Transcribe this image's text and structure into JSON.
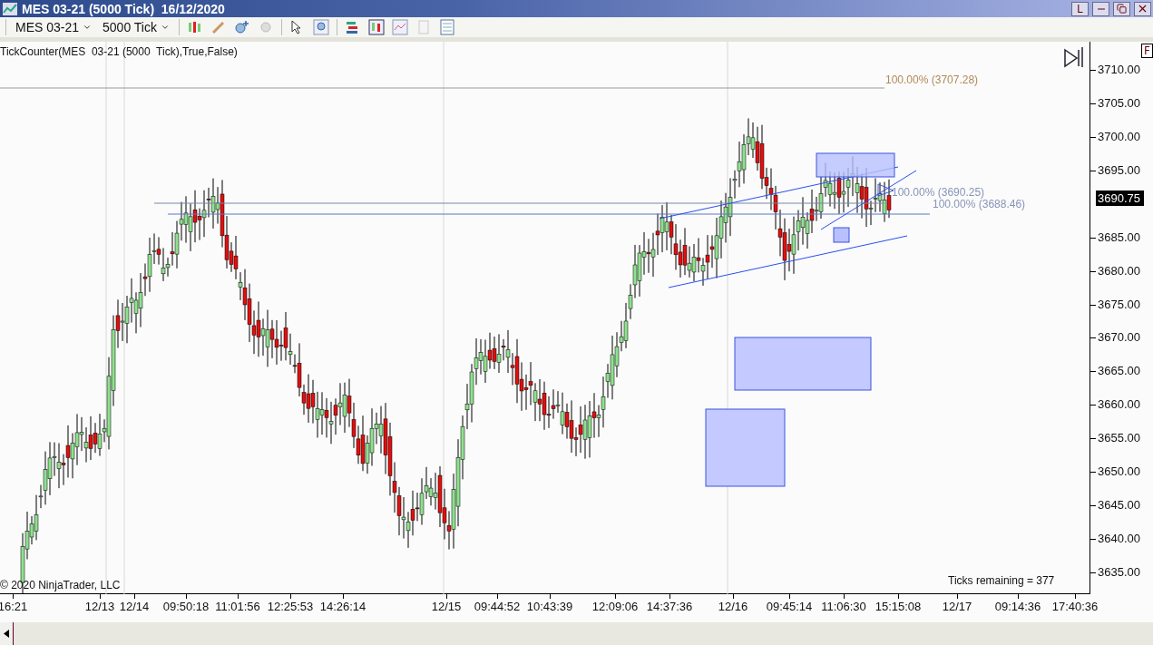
{
  "window": {
    "title": "MES 03-21 (5000 Tick)  16/12/2020",
    "buttons": [
      "L"
    ]
  },
  "toolbar": {
    "instrument": "MES 03-21",
    "interval": "5000 Tick"
  },
  "chart": {
    "indicator_label": "TickCounter(MES  03-21 (5000  Tick),True,False)",
    "copyright": "© 2020 NinjaTrader, LLC",
    "ticks_remaining": "Ticks remaining = 377",
    "fib_labels": [
      "100.00% (3707.28)",
      "100.00% (3690.25)",
      "100.00% (3688.46)"
    ],
    "last_price": "3690.75",
    "price_axis": [
      "3710.00",
      "3705.00",
      "3700.00",
      "3695.00",
      "3685.00",
      "3680.00",
      "3675.00",
      "3670.00",
      "3665.00",
      "3660.00",
      "3655.00",
      "3650.00",
      "3645.00",
      "3640.00",
      "3635.00"
    ],
    "time_axis": [
      "16:21",
      "12/13",
      "12/14",
      "09:50:18",
      "11:01:56",
      "12:25:53",
      "14:26:14",
      "12/15",
      "09:44:52",
      "10:43:39",
      "12:09:06",
      "14:37:36",
      "12/16",
      "09:45:14",
      "11:06:30",
      "15:15:08",
      "12/17",
      "09:14:36",
      "17:40:36"
    ]
  },
  "side_tab": "F"
}
